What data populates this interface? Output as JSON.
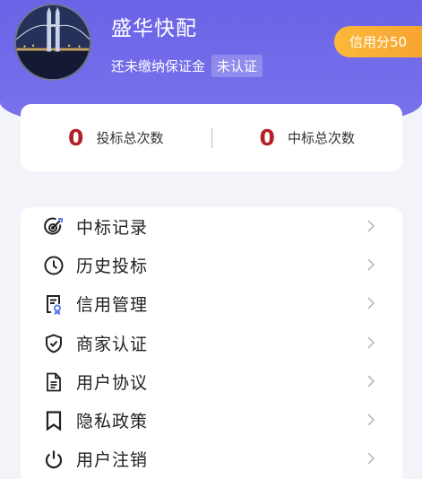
{
  "profile": {
    "name": "盛华快配",
    "deposit_status": "还未缴纳保证金",
    "verify_badge": "未认证",
    "credit_label": "信用分50"
  },
  "stats": {
    "bid_count_value": "0",
    "bid_count_label": "投标总次数",
    "win_count_value": "0",
    "win_count_label": "中标总次数"
  },
  "menu": {
    "items": [
      {
        "label": "中标记录",
        "icon": "target-icon"
      },
      {
        "label": "历史投标",
        "icon": "clock-icon"
      },
      {
        "label": "信用管理",
        "icon": "certificate-icon"
      },
      {
        "label": "商家认证",
        "icon": "shield-check-icon"
      },
      {
        "label": "用户协议",
        "icon": "document-icon"
      },
      {
        "label": "隐私政策",
        "icon": "bookmark-icon"
      },
      {
        "label": "用户注销",
        "icon": "power-icon"
      }
    ]
  },
  "colors": {
    "header": "#6a63e6",
    "credit": "#f7a531",
    "stat_number": "#b4202a"
  }
}
